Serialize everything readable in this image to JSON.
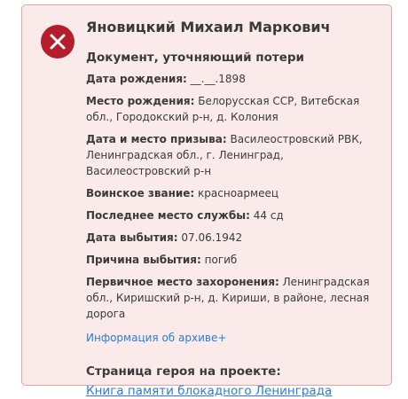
{
  "card": {
    "status_icon": "close-x-icon",
    "colors": {
      "background": "#fbeaea",
      "border": "#e0a3a6",
      "icon_circle": "#b31e2a",
      "link": "#2a7fd4"
    },
    "name": "Яновицкий Михаил Маркович",
    "doc_type": "Документ, уточняющий потери",
    "fields": [
      {
        "label": "Дата рождения:",
        "value": "__.__.1898"
      },
      {
        "label": "Место рождения:",
        "value": "Белорусская ССР, Витебская обл., Городокский р-н, д. Колония"
      },
      {
        "label": "Дата и место призыва:",
        "value": "Василеостровский РВК, Ленинградская обл., г. Ленинград, Василеостровский р-н"
      },
      {
        "label": "Воинское звание:",
        "value": "красноармеец"
      },
      {
        "label": "Последнее место службы:",
        "value": "44 сд"
      },
      {
        "label": "Дата выбытия:",
        "value": "07.06.1942"
      },
      {
        "label": "Причина выбытия:",
        "value": "погиб"
      },
      {
        "label": "Первичное место захоронения:",
        "value": "Ленинградская обл., Киришский р-н, д. Кириши, в районе, лесная дорога"
      }
    ],
    "archive_link": "Информация об архиве+",
    "hero_title": "Страница героя на проекте:",
    "hero_link": "Книга памяти блокадного Ленинграда"
  }
}
